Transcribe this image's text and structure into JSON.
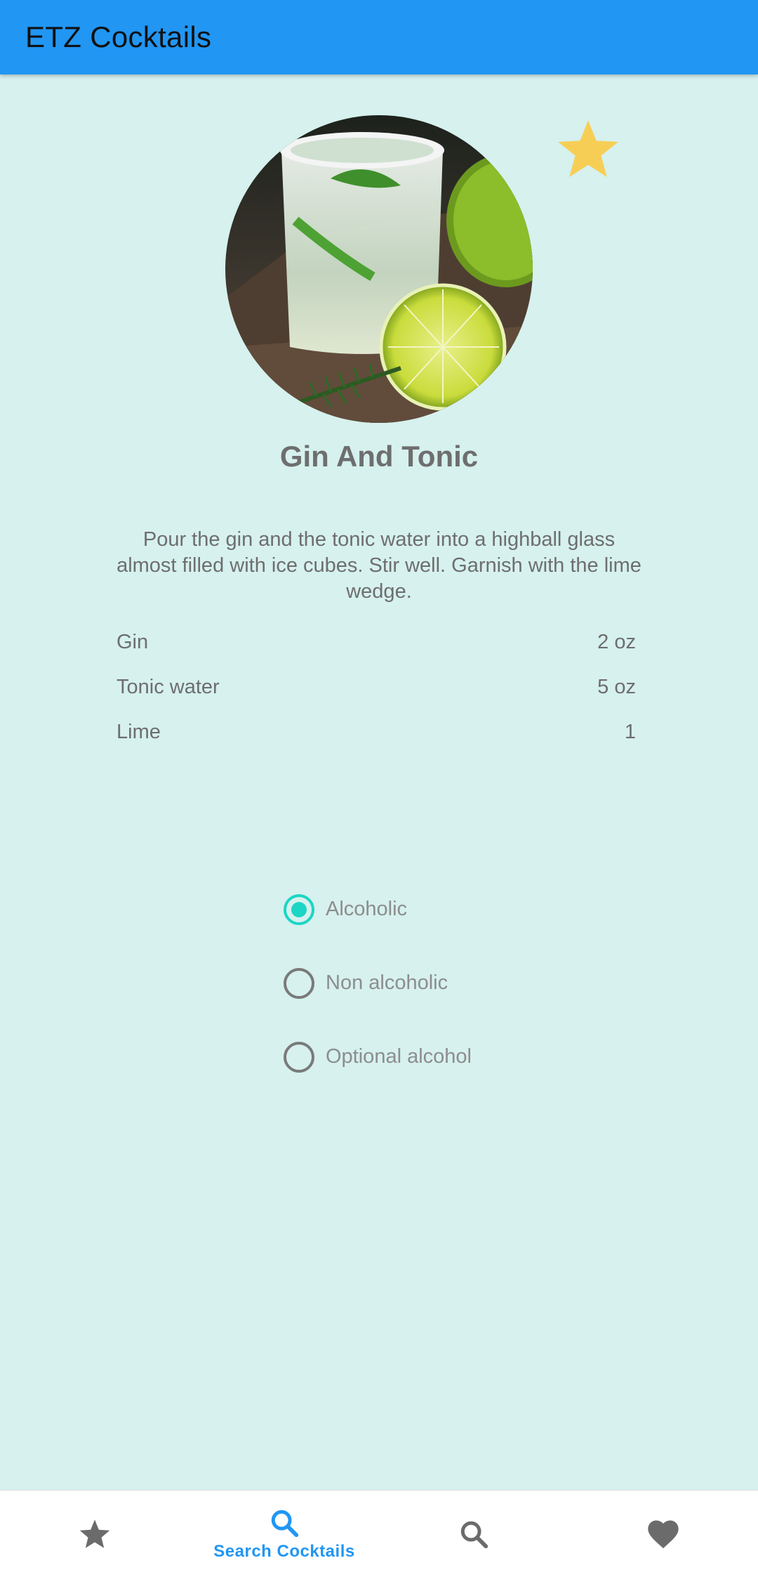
{
  "app_bar": {
    "title": "ETZ Cocktails"
  },
  "drink": {
    "name": "Gin And Tonic",
    "instructions": "Pour the gin and the tonic water into a highball glass almost filled with ice cubes. Stir well. Garnish with the lime wedge.",
    "favorite": true,
    "ingredients": [
      {
        "name": "Gin",
        "measure": "2 oz"
      },
      {
        "name": "Tonic water",
        "measure": "5 oz"
      },
      {
        "name": "Lime",
        "measure": "1"
      }
    ]
  },
  "alcohol_filter": {
    "options": [
      "Alcoholic",
      "Non alcoholic",
      "Optional alcohol"
    ],
    "selected": "Alcoholic"
  },
  "bottom_nav": {
    "items": [
      {
        "icon": "star-icon",
        "label": ""
      },
      {
        "icon": "search-icon",
        "label": "Search Cocktails",
        "active": true
      },
      {
        "icon": "search-icon",
        "label": ""
      },
      {
        "icon": "heart-icon",
        "label": ""
      }
    ]
  },
  "colors": {
    "app_bar": "#2196F3",
    "background": "#D6F1EE",
    "accent": "#1DD5C5",
    "star": "#F7CE55"
  }
}
